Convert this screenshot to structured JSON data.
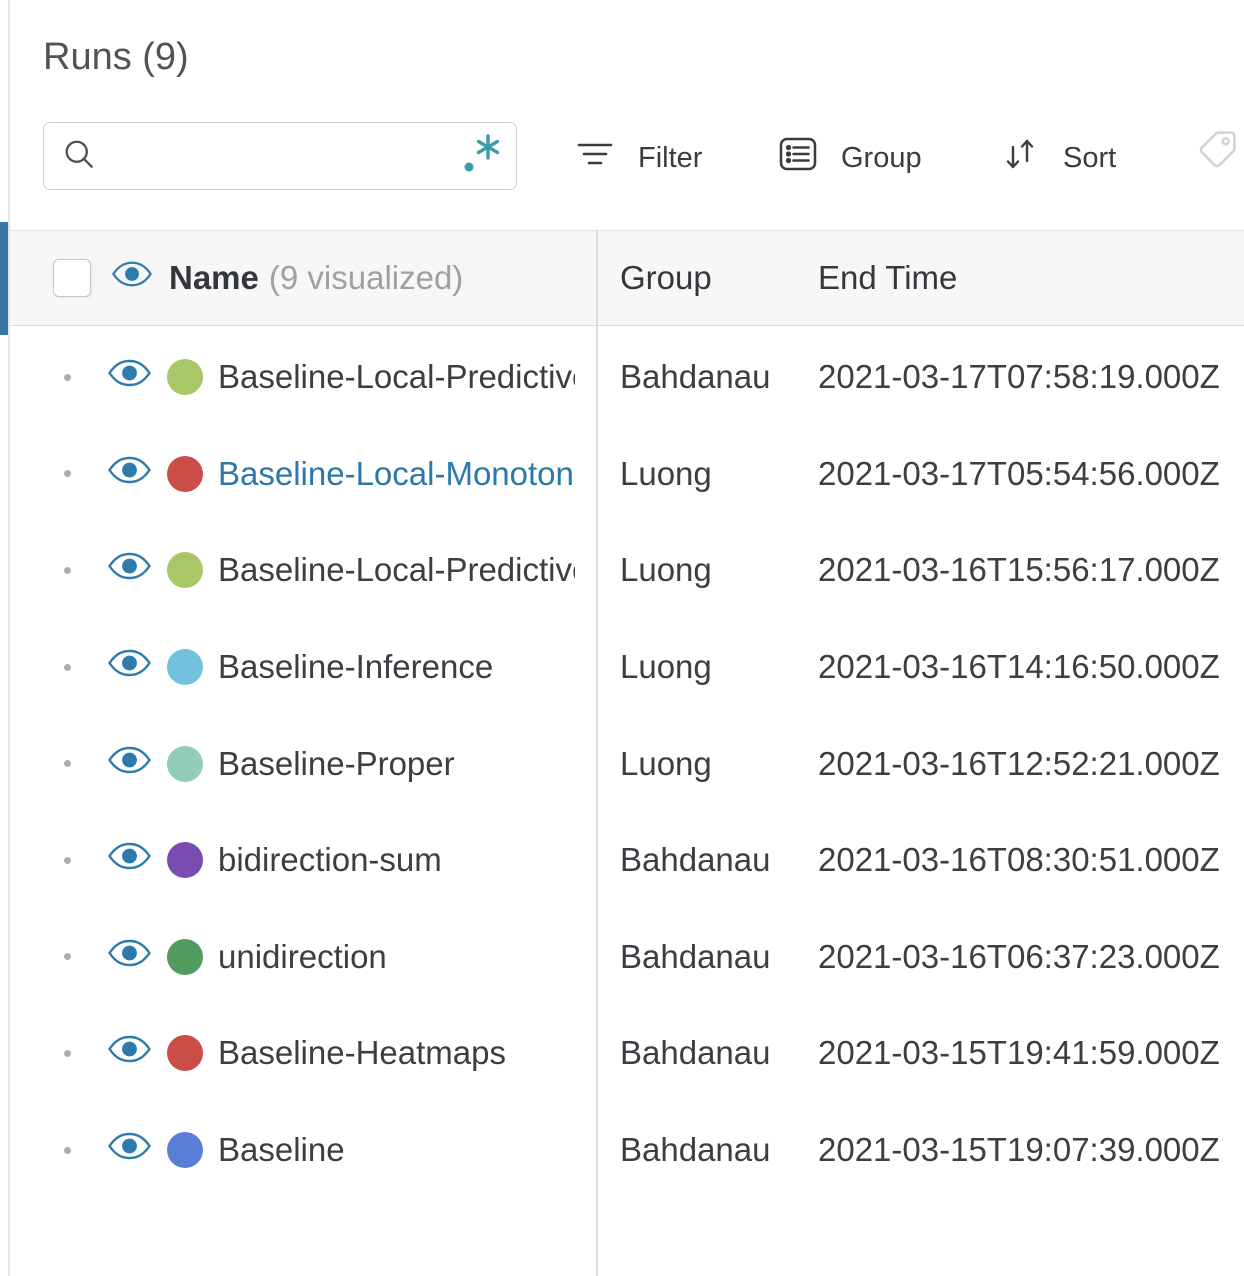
{
  "title": "Runs (9)",
  "search": {
    "value": "",
    "placeholder": ""
  },
  "toolbar": {
    "filter": "Filter",
    "group": "Group",
    "sort": "Sort"
  },
  "table": {
    "header": {
      "name": "Name",
      "visualized": "(9 visualized)",
      "group": "Group",
      "end_time": "End Time"
    },
    "rows": [
      {
        "name": "Baseline-Local-Predictive",
        "color": "#A8C766",
        "group": "Bahdanau",
        "end_time": "2021-03-17T07:58:19.000Z"
      },
      {
        "name": "Baseline-Local-Monotonic",
        "color": "#CB4D48",
        "group": "Luong",
        "end_time": "2021-03-17T05:54:56.000Z"
      },
      {
        "name": "Baseline-Local-Predictive",
        "color": "#A8C766",
        "group": "Luong",
        "end_time": "2021-03-16T15:56:17.000Z"
      },
      {
        "name": "Baseline-Inference",
        "color": "#72C2DE",
        "group": "Luong",
        "end_time": "2021-03-16T14:16:50.000Z"
      },
      {
        "name": "Baseline-Proper",
        "color": "#93CCB8",
        "group": "Luong",
        "end_time": "2021-03-16T12:52:21.000Z"
      },
      {
        "name": "bidirection-sum",
        "color": "#7A4BB0",
        "group": "Bahdanau",
        "end_time": "2021-03-16T08:30:51.000Z"
      },
      {
        "name": "unidirection",
        "color": "#529B5F",
        "group": "Bahdanau",
        "end_time": "2021-03-16T06:37:23.000Z"
      },
      {
        "name": "Baseline-Heatmaps",
        "color": "#CB4D48",
        "group": "Bahdanau",
        "end_time": "2021-03-15T19:41:59.000Z"
      },
      {
        "name": "Baseline",
        "color": "#5A7DD7",
        "group": "Bahdanau",
        "end_time": "2021-03-15T19:07:39.000Z"
      }
    ]
  },
  "colors": {
    "eye_blue": "#2D7BAC",
    "link_blue": "#2C78A9",
    "regex_teal": "#3C9AAD",
    "scrollbar_blue": "#3877A4"
  }
}
